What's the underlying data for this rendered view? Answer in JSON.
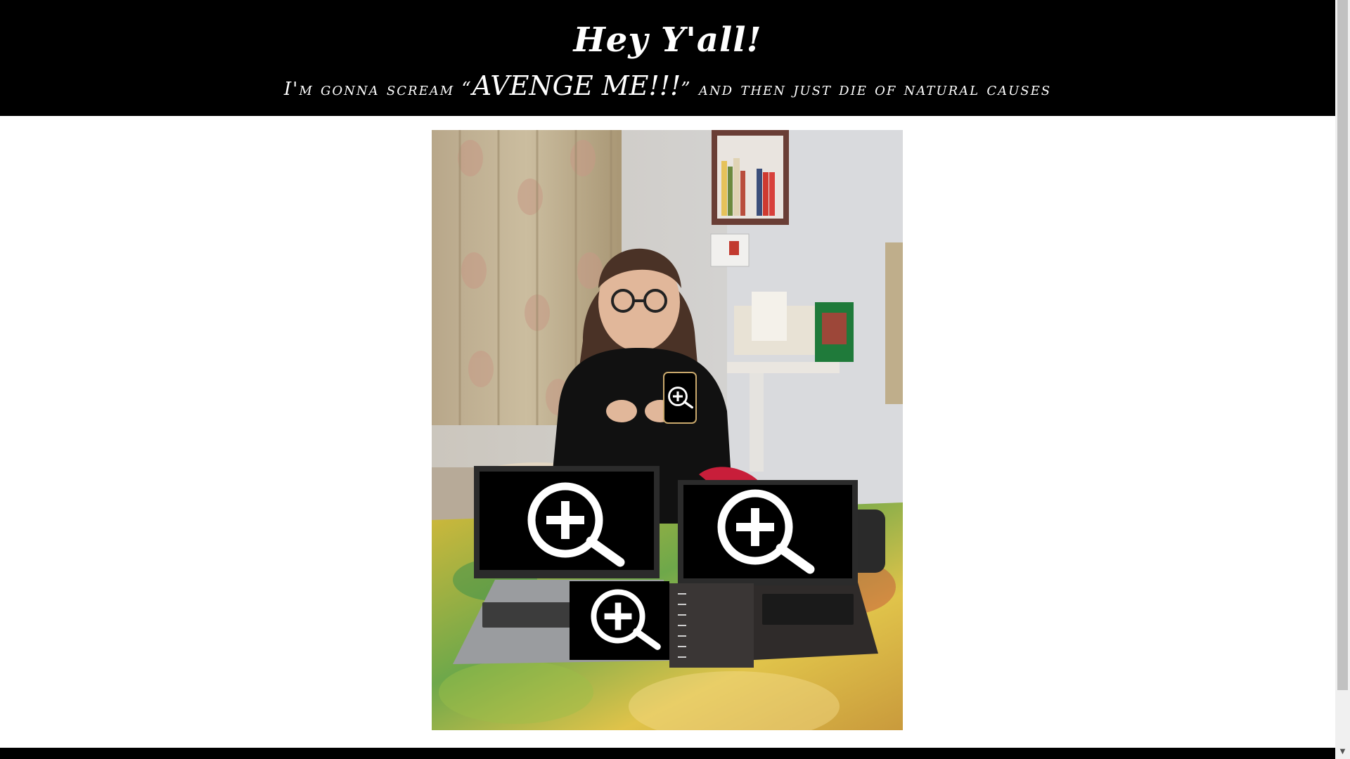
{
  "header": {
    "title": "Hey Y'all!",
    "subtitle_before": "I'm gonna scream “",
    "subtitle_shout": "AVENGE ME!!!",
    "subtitle_after": "” and then just die of natural causes"
  },
  "scrollbar": {
    "down_arrow": "▼"
  },
  "colors": {
    "header_bg": "#000000",
    "header_text": "#ffffff",
    "page_bg": "#ffffff"
  }
}
